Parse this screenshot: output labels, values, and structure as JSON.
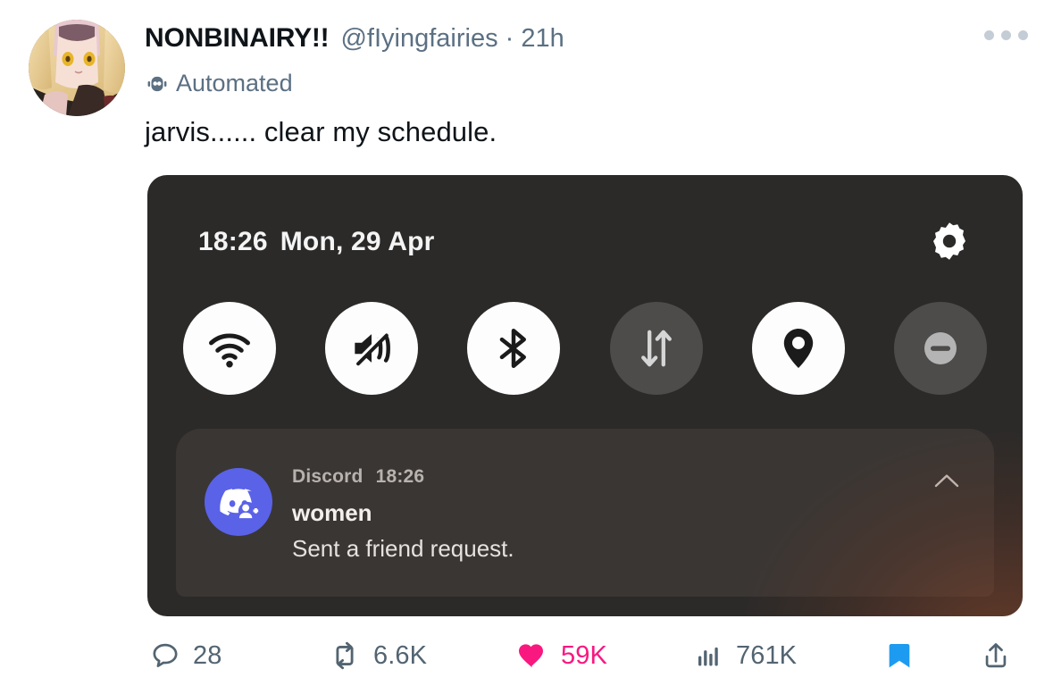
{
  "tweet": {
    "display_name": "NONBINAIRY!!",
    "handle": "@fIyingfairies",
    "separator": "·",
    "timestamp": "21h",
    "automated_label": "Automated",
    "automated_icon": "robot-icon",
    "more_icon": "more-options-icon",
    "text": "jarvis......  clear my schedule.",
    "avatar_alt": "anime-character-avatar"
  },
  "media": {
    "type": "android-notification-shade-screenshot",
    "status_bar": {
      "time": "18:26",
      "date": "Mon, 29 Apr",
      "settings_icon": "gear-icon"
    },
    "quick_toggles": [
      {
        "name": "wifi",
        "icon": "wifi-icon",
        "state": "on",
        "label": "Wi-Fi"
      },
      {
        "name": "sound",
        "icon": "mute-vibrate-icon",
        "state": "on",
        "label": "Mute / Vibrate"
      },
      {
        "name": "bluetooth",
        "icon": "bluetooth-icon",
        "state": "on",
        "label": "Bluetooth"
      },
      {
        "name": "mobile-data",
        "icon": "mobile-data-icon",
        "state": "off",
        "label": "Mobile data"
      },
      {
        "name": "location",
        "icon": "location-pin-icon",
        "state": "on",
        "label": "Location"
      },
      {
        "name": "do-not-disturb",
        "icon": "do-not-disturb-icon",
        "state": "off",
        "label": "Do not disturb"
      }
    ],
    "notification": {
      "app_name": "Discord",
      "app_icon": "discord-friend-request-icon",
      "time": "18:26",
      "title": "women",
      "body": "Sent a friend request.",
      "collapse_icon": "chevron-up-icon",
      "brand_color": "#5865F2"
    },
    "panel_color": "#2b2a29",
    "card_color": "#3a3634"
  },
  "actions": {
    "reply": {
      "icon": "reply-icon",
      "count": "28"
    },
    "retweet": {
      "icon": "retweet-icon",
      "count": "6.6K"
    },
    "like": {
      "icon": "heart-filled-icon",
      "count": "59K",
      "color": "#f91880",
      "active": true
    },
    "views": {
      "icon": "analytics-bars-icon",
      "count": "761K"
    },
    "bookmark": {
      "icon": "bookmark-filled-icon",
      "color": "#1d9bf0",
      "active": true
    },
    "share": {
      "icon": "share-upload-icon"
    }
  },
  "colors": {
    "text_primary": "#0f1419",
    "text_muted": "#536471",
    "handle": "#5b7083",
    "like": "#f91880",
    "bookmark": "#1d9bf0",
    "background": "#ffffff"
  }
}
